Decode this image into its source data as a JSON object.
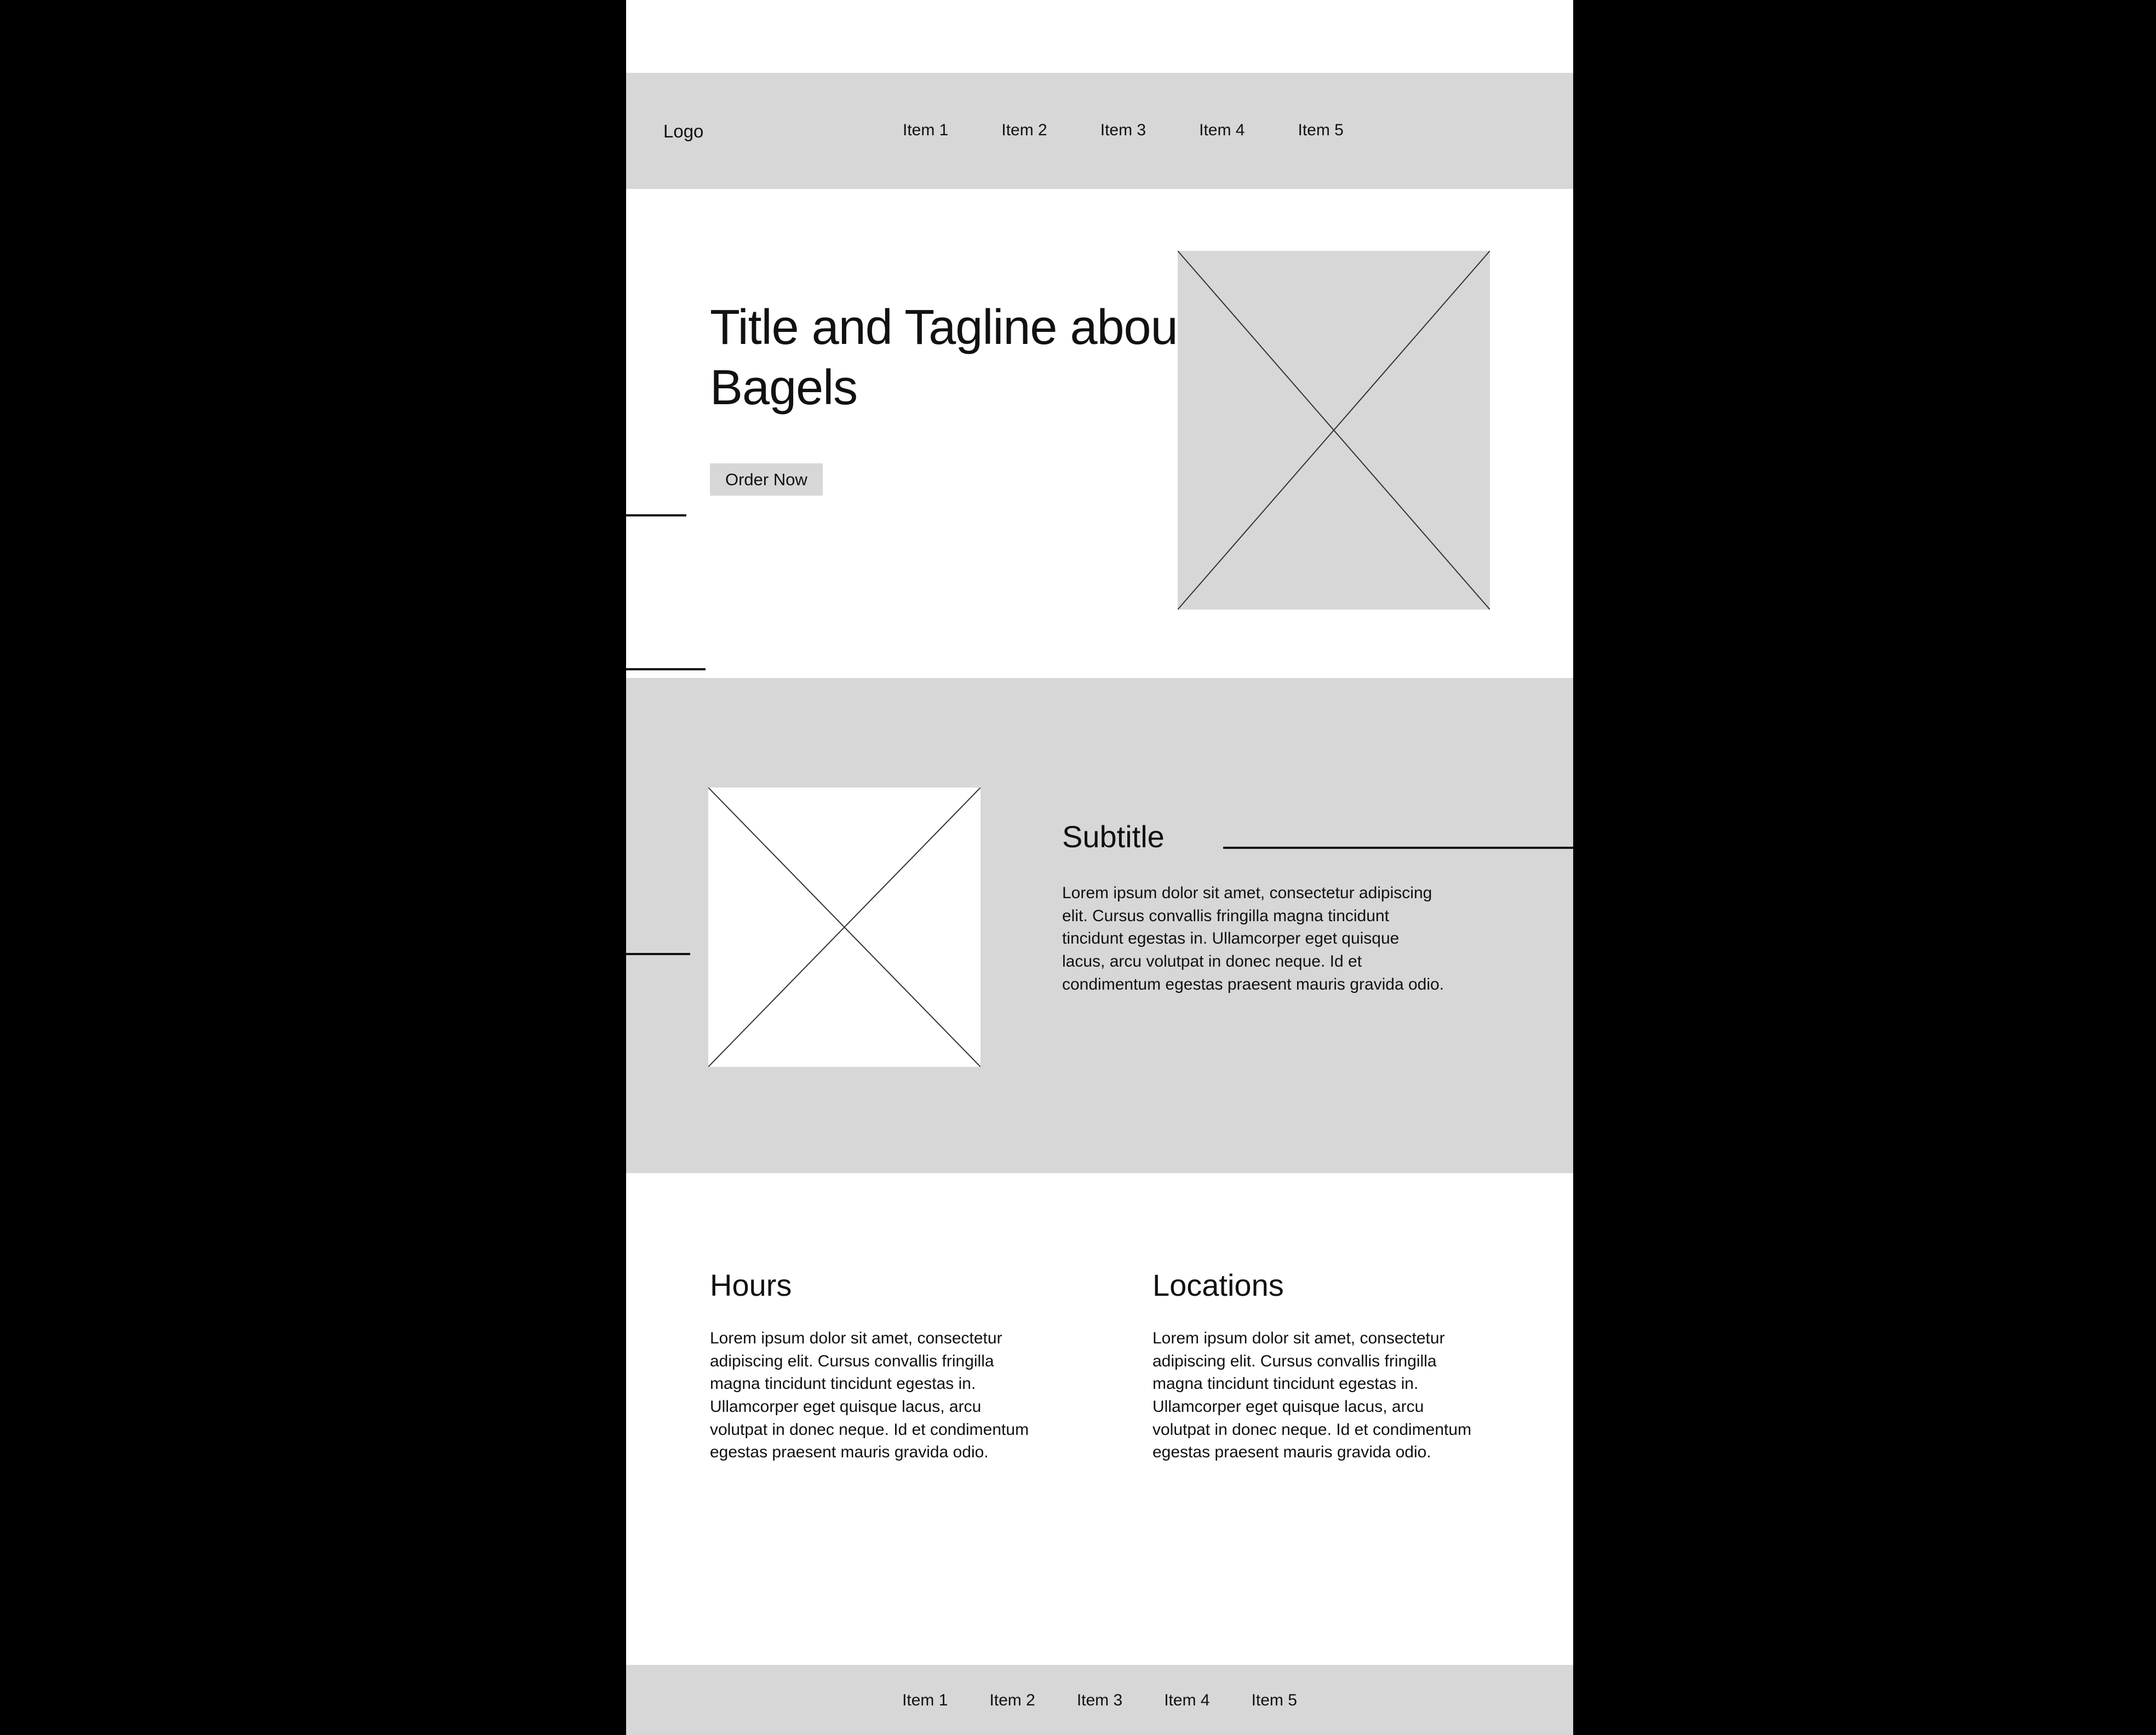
{
  "colors": {
    "page_background": "#ffffff",
    "canvas_background": "#000000",
    "band_gray": "#d7d7d7",
    "ink": "#111111"
  },
  "header": {
    "logo": "Logo",
    "nav_items": [
      {
        "label": "Item 1"
      },
      {
        "label": "Item 2"
      },
      {
        "label": "Item 3"
      },
      {
        "label": "Item 4"
      },
      {
        "label": "Item 5"
      }
    ]
  },
  "hero": {
    "title": "Title and Tagline about Bagels",
    "cta_label": "Order Now",
    "image_placeholder": "image-placeholder-x"
  },
  "feature": {
    "image_placeholder": "image-placeholder-x",
    "subtitle": "Subtitle",
    "body": "Lorem ipsum dolor sit amet, consectetur adipiscing elit. Cursus convallis fringilla magna tincidunt tincidunt egestas in. Ullamcorper eget quisque lacus, arcu volutpat in donec neque. Id et condimentum egestas praesent mauris gravida odio."
  },
  "info": {
    "columns": [
      {
        "heading": "Hours",
        "body": "Lorem ipsum dolor sit amet, consectetur adipiscing elit. Cursus convallis fringilla magna tincidunt tincidunt egestas in. Ullamcorper eget quisque lacus, arcu volutpat in donec neque. Id et condimentum egestas praesent mauris gravida odio."
      },
      {
        "heading": "Locations",
        "body": "Lorem ipsum dolor sit amet, consectetur adipiscing elit. Cursus convallis fringilla magna tincidunt tincidunt egestas in. Ullamcorper eget quisque lacus, arcu volutpat in donec neque. Id et condimentum egestas praesent mauris gravida odio."
      }
    ]
  },
  "footer": {
    "nav_items": [
      {
        "label": "Item 1"
      },
      {
        "label": "Item 2"
      },
      {
        "label": "Item 3"
      },
      {
        "label": "Item 4"
      },
      {
        "label": "Item 5"
      }
    ]
  }
}
